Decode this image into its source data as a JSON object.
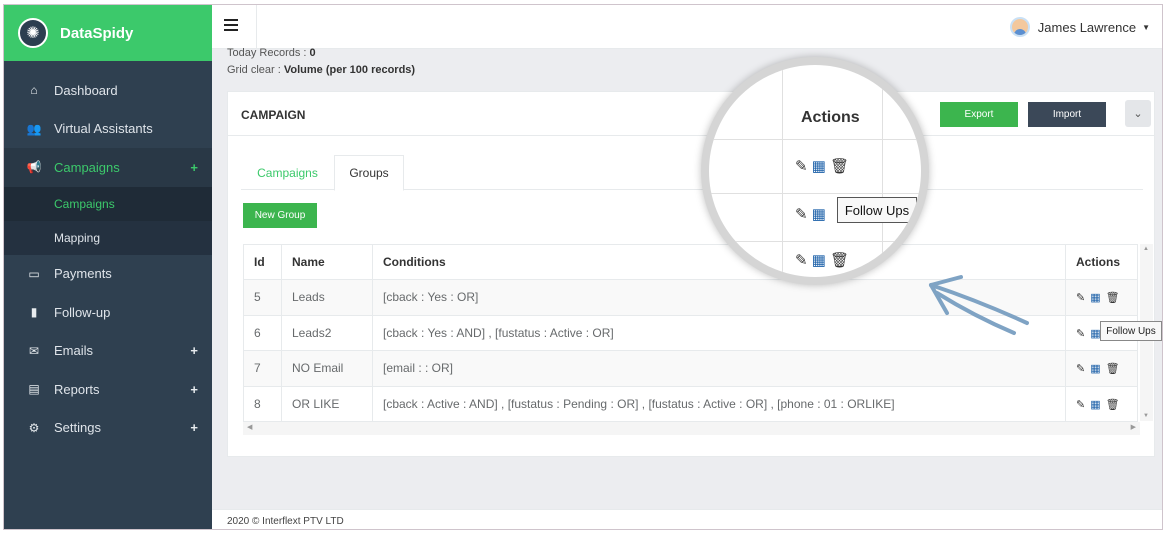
{
  "brand": {
    "name": "DataSpidy",
    "logo_icon": "spider-web-icon"
  },
  "sidebar": {
    "items": [
      {
        "label": "Dashboard",
        "icon": "⌂",
        "has_plus": false
      },
      {
        "label": "Virtual Assistants",
        "icon": "👥",
        "has_plus": false
      },
      {
        "label": "Campaigns",
        "icon": "📢",
        "has_plus": true,
        "plus": "+",
        "active": true
      },
      {
        "label": "Payments",
        "icon": "▭",
        "has_plus": false
      },
      {
        "label": "Follow-up",
        "icon": "▮",
        "has_plus": false
      },
      {
        "label": "Emails",
        "icon": "✉",
        "has_plus": true,
        "plus": "+"
      },
      {
        "label": "Reports",
        "icon": "▤",
        "has_plus": true,
        "plus": "+"
      },
      {
        "label": "Settings",
        "icon": "⚙",
        "has_plus": true,
        "plus": "+"
      }
    ],
    "subitems": [
      {
        "label": "Campaigns",
        "current": true
      },
      {
        "label": "Mapping",
        "current": false
      }
    ]
  },
  "topbar": {
    "user_name": "James Lawrence",
    "caret": "▼"
  },
  "stats": {
    "today_label": "Today Records :",
    "today_value": "0",
    "grid_label": "Grid clear :",
    "grid_value": "Volume (per 100 records)"
  },
  "panel": {
    "title": "CAMPAIGN",
    "export_label": "Export",
    "import_label": "Import",
    "collapse_icon": "⌄",
    "tabs": [
      "Campaigns",
      "Groups"
    ],
    "new_group_label": "New Group"
  },
  "table": {
    "headers": [
      "Id",
      "Name",
      "Conditions",
      "Actions"
    ],
    "rows": [
      {
        "id": "5",
        "name": "Leads",
        "conditions": "[cback : Yes : OR]"
      },
      {
        "id": "6",
        "name": "Leads2",
        "conditions": "[cback : Yes : AND] , [fustatus : Active : OR]"
      },
      {
        "id": "7",
        "name": "NO Email",
        "conditions": "[email : : OR]"
      },
      {
        "id": "8",
        "name": "OR LIKE",
        "conditions": "[cback : Active : AND] , [fustatus : Pending : OR] , [fustatus : Active : OR] , [phone : 01 : ORLIKE]"
      }
    ],
    "action_icons": {
      "edit": "✎",
      "calendar": "▦",
      "delete": "🗑"
    }
  },
  "tooltip": {
    "label": "Follow Ups"
  },
  "magnifier": {
    "actions_header": "Actions",
    "tooltip": "Follow Ups"
  },
  "footer": {
    "text": "2020 © Interflext PTV LTD"
  }
}
